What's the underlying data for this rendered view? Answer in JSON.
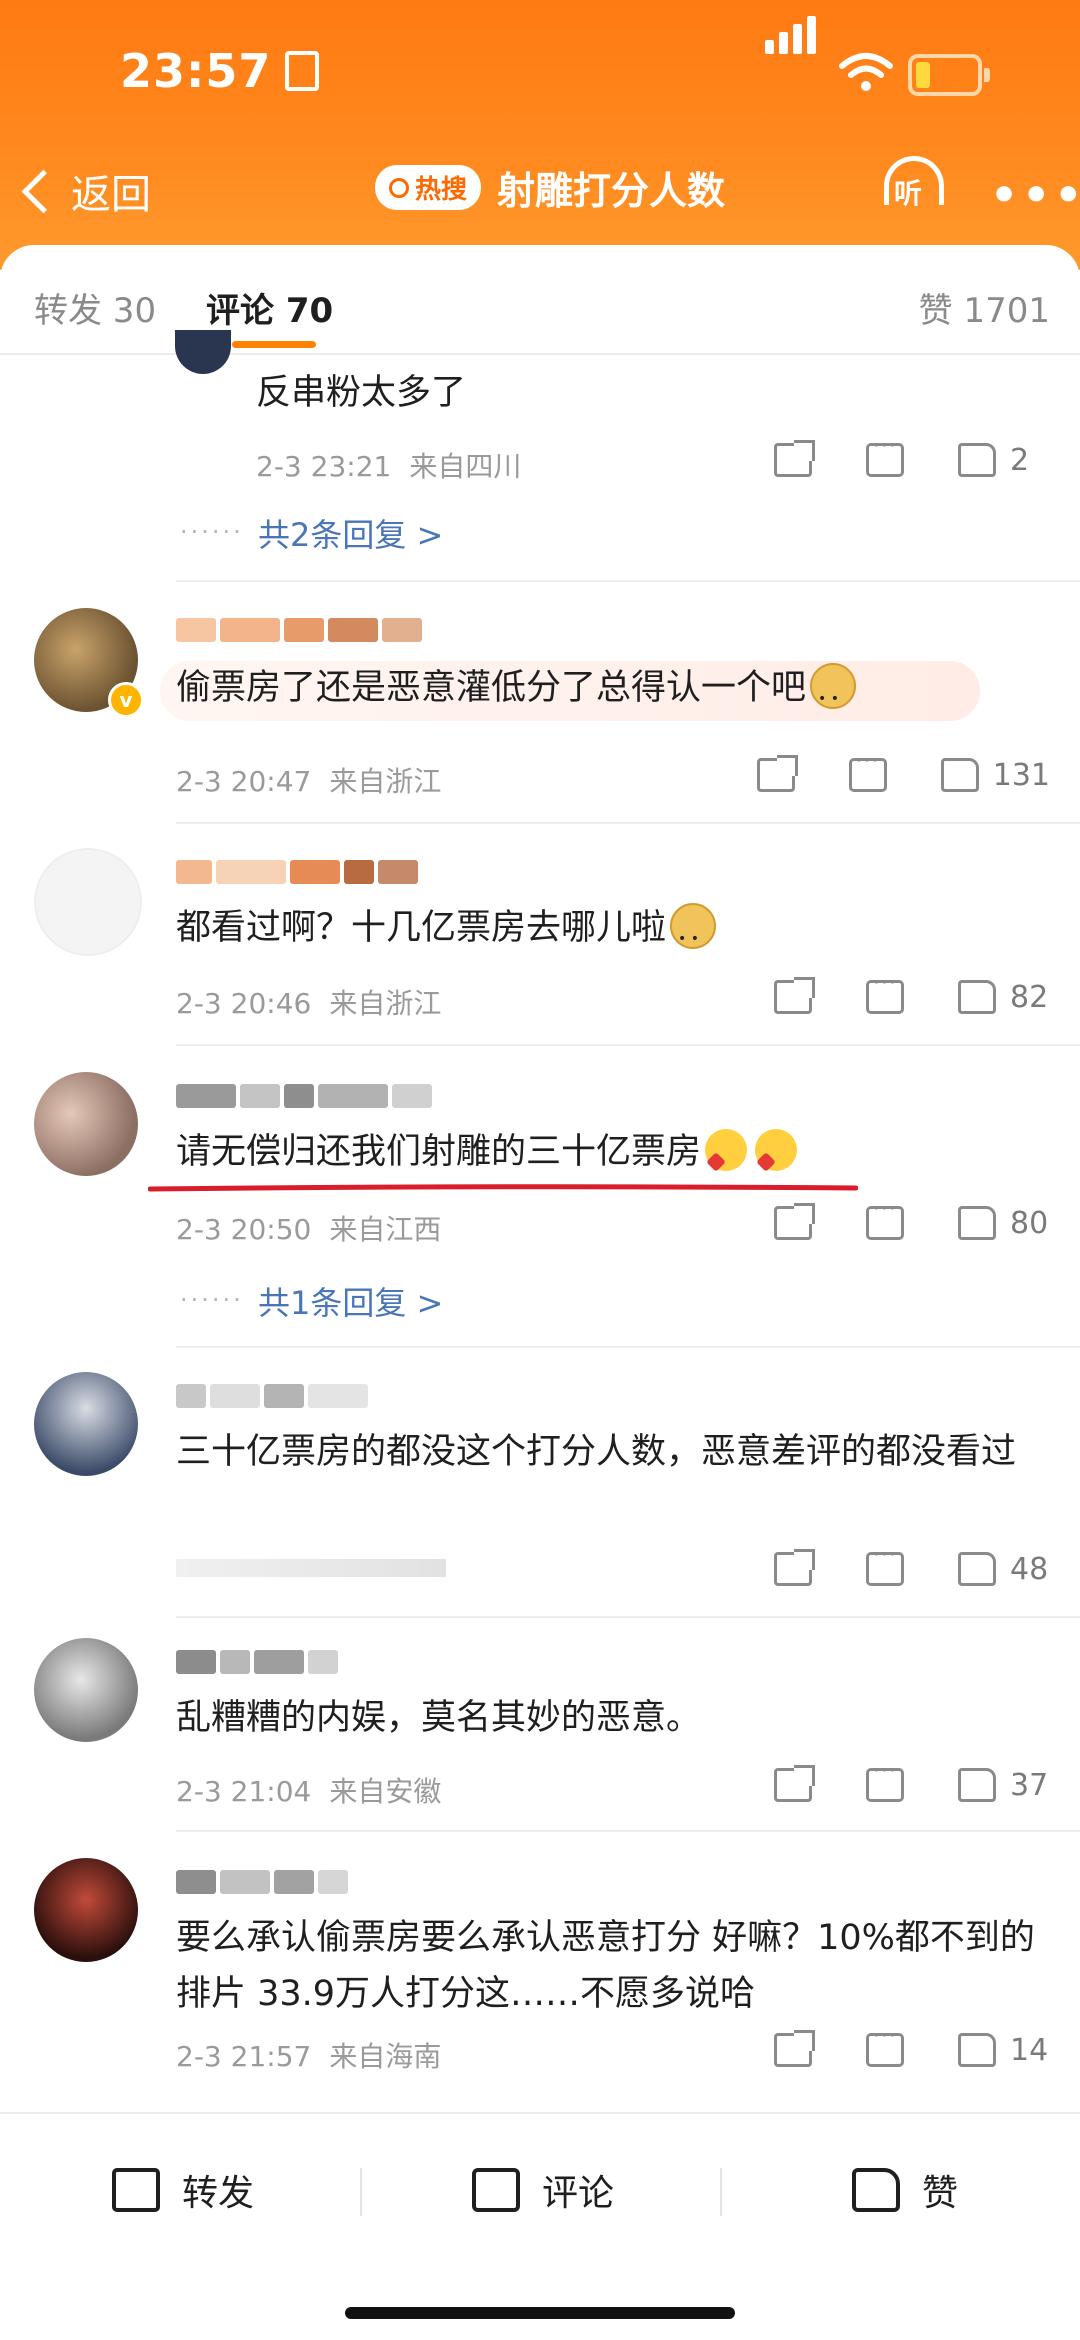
{
  "status_bar": {
    "time": "23:57"
  },
  "nav": {
    "back_label": "返回",
    "hot_label": "热搜",
    "title": "射雕打分人数",
    "listen_label": "听",
    "more_label": "•••"
  },
  "tabs": {
    "repost": "转发 30",
    "comment": "评论 70",
    "like": "赞 1701"
  },
  "comments": [
    {
      "text": "反串粉太多了",
      "date": "2-3 23:21",
      "location": "来自四川",
      "likes": "2",
      "replies": "共2条回复 >"
    },
    {
      "text": "偷票房了还是恶意灌低分了总得认一个吧",
      "date": "2-3 20:47",
      "location": "来自浙江",
      "likes": "131"
    },
    {
      "text": "都看过啊？十几亿票房去哪儿啦",
      "date": "2-3 20:46",
      "location": "来自浙江",
      "likes": "82"
    },
    {
      "text": "请无偿归还我们射雕的三十亿票房",
      "date": "2-3 20:50",
      "location": "来自江西",
      "likes": "80",
      "replies": "共1条回复 >"
    },
    {
      "text": "三十亿票房的都没这个打分人数，恶意差评的都没看过",
      "date": "",
      "location": "",
      "likes": "48"
    },
    {
      "text": "乱糟糟的内娱，莫名其妙的恶意。",
      "date": "2-3 21:04",
      "location": "来自安徽",
      "likes": "37"
    },
    {
      "text": "要么承认偷票房要么承认恶意打分 好嘛？10%都不到的排片 33.9万人打分这……不愿多说哈",
      "date": "2-3 21:57",
      "location": "来自海南",
      "likes": "14"
    }
  ],
  "bottom_bar": {
    "repost": "转发",
    "comment": "评论",
    "like": "赞"
  },
  "colors": {
    "accent": "#ff8200",
    "reply_link": "#4a76b8",
    "underline_red": "#d81e2c"
  }
}
